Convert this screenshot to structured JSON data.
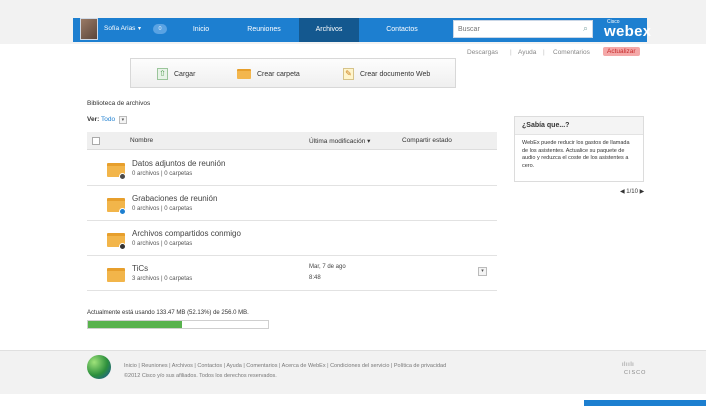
{
  "header": {
    "user_name": "Sofía Arias",
    "notifications": "0",
    "nav": [
      "Inicio",
      "Reuniones",
      "Archivos",
      "Contactos"
    ],
    "active_nav": "Archivos",
    "search_placeholder": "Buscar",
    "logo_cisco": "Cisco",
    "logo_webex": "webex"
  },
  "utility_links": {
    "downloads": "Descargas",
    "help": "Ayuda",
    "comments": "Comentarios",
    "upgrade": "Actualizar"
  },
  "actions": {
    "upload": "Cargar",
    "create_folder": "Crear carpeta",
    "create_web_doc": "Crear documento Web"
  },
  "library": {
    "breadcrumb": "Biblioteca de archivos",
    "view_label": "Ver:",
    "view_value": "Todo",
    "columns": {
      "name": "Nombre",
      "modified": "Última modificación",
      "share": "Compartir estado"
    },
    "rows": [
      {
        "name": "Datos adjuntos de reunión",
        "meta": "0 archivos | 0 carpetas",
        "date": "",
        "time": ""
      },
      {
        "name": "Grabaciones de reunión",
        "meta": "0 archivos | 0 carpetas",
        "date": "",
        "time": ""
      },
      {
        "name": "Archivos compartidos conmigo",
        "meta": "0 archivos | 0 carpetas",
        "date": "",
        "time": ""
      },
      {
        "name": "TiCs",
        "meta": "3 archivos | 0 carpetas",
        "date": "Mar, 7 de ago",
        "time": "8:48"
      }
    ]
  },
  "storage": {
    "text": "Actualmente está usando 133.47 MB (52.13%) de 256.0 MB.",
    "percent": 52.13
  },
  "tip": {
    "title": "¿Sabía que...?",
    "body": "WebEx puede reducir los gastos de llamada de los asistentes. Actualice su paquete de audio y reduzca el coste de los asistentes a cero.",
    "pager": "1/10"
  },
  "footer": {
    "links": "Inicio | Reuniones | Archivos | Contactos | Ayuda | Comentarios | Acerca de WebEx | Condiciones del servicio | Política de privacidad",
    "copyright": "©2012 Cisco y/o sus afiliados. Todos los derechos reservados.",
    "cisco_word": "CISCO"
  }
}
